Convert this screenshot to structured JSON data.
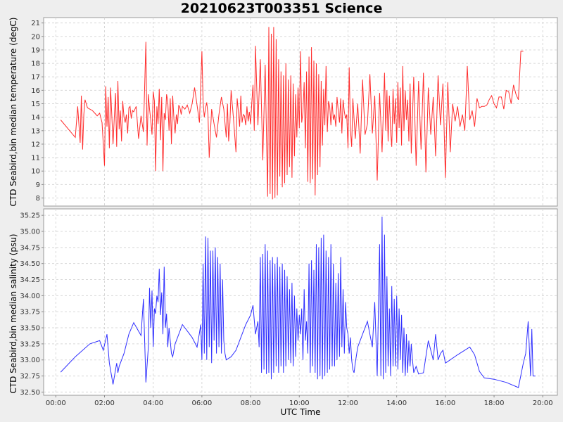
{
  "title": "20210623T003351 Science",
  "colors": {
    "temperature": "#ff2d2d",
    "salinity": "#2f2fff",
    "plot_bg": "#ffffff",
    "page_bg": "#eeeeee"
  },
  "chart_data": [
    {
      "type": "line",
      "name": "temperature",
      "ylabel": "CTD Seabird,bin median temperature (degC)",
      "xlabel": "",
      "xlim": [
        -0.5,
        20.6
      ],
      "ylim": [
        7.4,
        21.4
      ],
      "yticks": [
        8,
        9,
        10,
        11,
        12,
        13,
        14,
        15,
        16,
        17,
        18,
        19,
        20,
        21
      ],
      "ytick_labels": [
        "8",
        "9",
        "10",
        "11",
        "12",
        "13",
        "14",
        "15",
        "16",
        "17",
        "18",
        "19",
        "20",
        "21"
      ],
      "grid": true,
      "x": [
        0.2,
        0.8,
        0.9,
        1.0,
        1.05,
        1.1,
        1.15,
        1.2,
        1.3,
        1.4,
        1.5,
        1.6,
        1.7,
        1.8,
        1.9,
        2.0,
        2.05,
        2.1,
        2.15,
        2.2,
        2.25,
        2.3,
        2.35,
        2.45,
        2.5,
        2.55,
        2.6,
        2.65,
        2.7,
        2.75,
        2.8,
        2.85,
        2.9,
        2.95,
        3.0,
        3.05,
        3.1,
        3.15,
        3.2,
        3.3,
        3.4,
        3.5,
        3.6,
        3.7,
        3.75,
        3.8,
        3.85,
        3.9,
        3.95,
        4.0,
        4.05,
        4.1,
        4.15,
        4.2,
        4.25,
        4.3,
        4.35,
        4.4,
        4.45,
        4.5,
        4.55,
        4.6,
        4.65,
        4.7,
        4.75,
        4.8,
        4.85,
        4.9,
        4.95,
        5.0,
        5.05,
        5.1,
        5.15,
        5.2,
        5.3,
        5.4,
        5.5,
        5.6,
        5.7,
        5.8,
        5.9,
        6.0,
        6.05,
        6.1,
        6.15,
        6.2,
        6.25,
        6.3,
        6.4,
        6.5,
        6.6,
        6.7,
        6.8,
        6.9,
        7.0,
        7.05,
        7.1,
        7.15,
        7.2,
        7.3,
        7.4,
        7.45,
        7.5,
        7.55,
        7.6,
        7.65,
        7.7,
        7.75,
        7.8,
        7.85,
        7.9,
        7.95,
        8.0,
        8.05,
        8.1,
        8.15,
        8.2,
        8.3,
        8.4,
        8.5,
        8.6,
        8.7,
        8.75,
        8.8,
        8.85,
        8.9,
        8.95,
        9.0,
        9.05,
        9.1,
        9.15,
        9.2,
        9.25,
        9.3,
        9.35,
        9.4,
        9.45,
        9.5,
        9.55,
        9.6,
        9.65,
        9.7,
        9.75,
        9.8,
        9.85,
        9.9,
        9.95,
        10.0,
        10.05,
        10.1,
        10.15,
        10.2,
        10.25,
        10.3,
        10.35,
        10.4,
        10.45,
        10.5,
        10.55,
        10.6,
        10.65,
        10.7,
        10.75,
        10.8,
        10.85,
        10.9,
        10.95,
        11.0,
        11.05,
        11.1,
        11.15,
        11.2,
        11.25,
        11.3,
        11.35,
        11.4,
        11.45,
        11.5,
        11.55,
        11.6,
        11.65,
        11.7,
        11.75,
        11.8,
        11.85,
        11.9,
        11.95,
        12.0,
        12.05,
        12.1,
        12.15,
        12.2,
        12.3,
        12.4,
        12.5,
        12.6,
        12.7,
        12.8,
        12.9,
        13.0,
        13.1,
        13.2,
        13.3,
        13.4,
        13.5,
        13.55,
        13.6,
        13.65,
        13.7,
        13.75,
        13.8,
        13.85,
        13.9,
        13.95,
        14.0,
        14.05,
        14.1,
        14.15,
        14.2,
        14.25,
        14.3,
        14.35,
        14.4,
        14.45,
        14.5,
        14.55,
        14.6,
        14.7,
        14.8,
        14.9,
        15.0,
        15.1,
        15.2,
        15.3,
        15.4,
        15.5,
        15.6,
        15.7,
        15.8,
        15.9,
        16.0,
        16.1,
        16.2,
        16.3,
        16.4,
        16.5,
        16.6,
        16.7,
        16.8,
        16.9,
        17.0,
        17.1,
        17.2,
        17.3,
        17.4,
        17.5,
        17.6,
        17.7,
        17.8,
        17.9,
        18.0,
        18.1,
        18.2,
        18.3,
        18.4,
        18.5,
        18.6,
        18.7,
        18.8,
        18.9,
        19.0,
        19.1,
        19.2,
        19.3,
        19.4,
        19.5,
        19.6,
        19.7,
        19.8
      ],
      "y": [
        13.8,
        12.5,
        14.8,
        12.1,
        15.6,
        11.6,
        14.2,
        15.3,
        14.7,
        14.6,
        14.5,
        14.3,
        14.1,
        14.3,
        13.6,
        10.4,
        16.3,
        13.3,
        15.5,
        11.7,
        16.2,
        14.1,
        12.0,
        15.8,
        11.8,
        16.7,
        13.1,
        14.5,
        12.2,
        15.2,
        14.0,
        13.6,
        14.2,
        12.8,
        14.7,
        14.8,
        13.9,
        14.5,
        14.4,
        14.8,
        12.4,
        14.1,
        12.9,
        19.6,
        11.9,
        15.7,
        14.6,
        13.8,
        12.7,
        15.9,
        15.2,
        10.0,
        14.8,
        13.5,
        16.1,
        12.3,
        15.5,
        10.0,
        14.3,
        13.8,
        15.7,
        15.2,
        13.0,
        15.4,
        12.0,
        15.6,
        13.9,
        12.8,
        14.2,
        13.5,
        14.9,
        14.7,
        14.2,
        14.8,
        14.6,
        14.9,
        14.3,
        15.0,
        16.2,
        14.9,
        13.6,
        18.9,
        15.1,
        14.0,
        14.7,
        15.1,
        14.2,
        11.0,
        14.6,
        13.5,
        12.5,
        14.2,
        15.5,
        14.6,
        12.5,
        15.0,
        12.2,
        13.6,
        16.0,
        13.8,
        11.4,
        15.4,
        14.4,
        13.3,
        15.6,
        13.6,
        14.2,
        14.1,
        13.4,
        14.8,
        13.7,
        14.4,
        13.5,
        15.1,
        16.4,
        13.0,
        19.3,
        13.4,
        18.3,
        10.8,
        17.9,
        8.1,
        20.7,
        8.3,
        20.2,
        7.9,
        20.7,
        8.0,
        19.8,
        8.2,
        18.3,
        9.6,
        17.4,
        8.8,
        17.1,
        9.1,
        18.0,
        9.7,
        16.8,
        10.3,
        17.1,
        9.5,
        16.5,
        11.1,
        15.7,
        12.5,
        16.2,
        13.2,
        18.9,
        13.6,
        14.4,
        16.6,
        11.7,
        17.4,
        9.2,
        18.5,
        9.1,
        19.2,
        9.4,
        18.2,
        8.2,
        18.0,
        9.7,
        17.2,
        10.3,
        16.7,
        11.9,
        16.1,
        13.4,
        17.8,
        12.9,
        15.2,
        14.8,
        13.4,
        15.1,
        13.8,
        14.2,
        13.3,
        15.5,
        14.5,
        13.6,
        15.4,
        12.8,
        15.3,
        14.4,
        13.9,
        14.2,
        11.7,
        17.7,
        13.1,
        11.8,
        15.4,
        12.4,
        15.0,
        11.3,
        16.8,
        12.7,
        13.5,
        17.2,
        12.8,
        15.6,
        9.3,
        15.8,
        11.4,
        17.3,
        13.0,
        16.0,
        12.2,
        15.6,
        13.0,
        11.8,
        16.1,
        13.5,
        15.4,
        12.1,
        16.6,
        13.2,
        16.2,
        11.9,
        17.8,
        13.0,
        16.0,
        13.8,
        15.3,
        12.2,
        16.5,
        11.3,
        17.0,
        10.4,
        16.7,
        11.6,
        17.3,
        9.9,
        16.2,
        12.7,
        15.5,
        11.1,
        17.1,
        13.4,
        16.5,
        9.5,
        16.6,
        11.4,
        15.0,
        13.7,
        14.8,
        13.3,
        14.2,
        13.0,
        17.8,
        13.8,
        14.5,
        13.3,
        15.4,
        14.7,
        14.8,
        14.8,
        14.9,
        15.3,
        15.6,
        15.0,
        14.7,
        15.5,
        15.5,
        14.6,
        16.0,
        15.9,
        15.0,
        16.4,
        15.7,
        15.3,
        18.9,
        18.9
      ]
    },
    {
      "type": "line",
      "name": "salinity",
      "ylabel": "CTD Seabird,bin median salinity (psu)",
      "xlabel": "UTC Time",
      "xlim": [
        -0.5,
        20.6
      ],
      "ylim": [
        32.45,
        35.35
      ],
      "yticks": [
        32.5,
        32.75,
        33.0,
        33.25,
        33.5,
        33.75,
        34.0,
        34.25,
        34.5,
        34.75,
        35.0,
        35.25
      ],
      "ytick_labels": [
        "32.50",
        "32.75",
        "33.00",
        "33.25",
        "33.50",
        "33.75",
        "34.00",
        "34.25",
        "34.50",
        "34.75",
        "35.00",
        "35.25"
      ],
      "xticks": [
        0,
        2,
        4,
        6,
        8,
        10,
        12,
        14,
        16,
        18,
        20
      ],
      "xtick_labels": [
        "00:00",
        "02:00",
        "04:00",
        "06:00",
        "08:00",
        "10:00",
        "12:00",
        "14:00",
        "16:00",
        "18:00",
        "20:00"
      ],
      "grid": true,
      "x": [
        0.2,
        0.8,
        1.4,
        1.8,
        1.95,
        2.1,
        2.2,
        2.35,
        2.5,
        2.55,
        2.6,
        2.8,
        3.0,
        3.2,
        3.5,
        3.6,
        3.7,
        3.8,
        3.85,
        3.9,
        3.95,
        4.0,
        4.05,
        4.1,
        4.15,
        4.2,
        4.25,
        4.3,
        4.35,
        4.4,
        4.45,
        4.5,
        4.55,
        4.6,
        4.65,
        4.7,
        4.75,
        4.8,
        4.85,
        4.9,
        4.95,
        5.0,
        5.2,
        5.4,
        5.6,
        5.8,
        5.9,
        5.95,
        6.0,
        6.05,
        6.1,
        6.15,
        6.2,
        6.25,
        6.3,
        6.35,
        6.4,
        6.45,
        6.5,
        6.55,
        6.6,
        6.65,
        6.7,
        6.75,
        6.8,
        6.85,
        6.9,
        6.95,
        7.0,
        7.2,
        7.4,
        7.6,
        7.8,
        8.0,
        8.1,
        8.2,
        8.3,
        8.35,
        8.4,
        8.45,
        8.5,
        8.55,
        8.6,
        8.65,
        8.7,
        8.75,
        8.8,
        8.85,
        8.9,
        8.95,
        9.0,
        9.05,
        9.1,
        9.15,
        9.2,
        9.25,
        9.3,
        9.35,
        9.4,
        9.45,
        9.5,
        9.55,
        9.6,
        9.65,
        9.7,
        9.75,
        9.8,
        9.85,
        9.9,
        9.95,
        10.0,
        10.05,
        10.1,
        10.15,
        10.2,
        10.25,
        10.3,
        10.35,
        10.4,
        10.45,
        10.5,
        10.55,
        10.6,
        10.65,
        10.7,
        10.75,
        10.8,
        10.85,
        10.9,
        10.95,
        11.0,
        11.05,
        11.1,
        11.15,
        11.2,
        11.25,
        11.3,
        11.35,
        11.4,
        11.45,
        11.5,
        11.55,
        11.6,
        11.65,
        11.7,
        11.75,
        11.8,
        11.85,
        11.9,
        11.95,
        12.0,
        12.05,
        12.1,
        12.15,
        12.2,
        12.25,
        12.3,
        12.4,
        12.6,
        12.8,
        13.0,
        13.1,
        13.2,
        13.3,
        13.35,
        13.4,
        13.45,
        13.5,
        13.55,
        13.6,
        13.65,
        13.7,
        13.75,
        13.8,
        13.85,
        13.9,
        13.95,
        14.0,
        14.05,
        14.1,
        14.15,
        14.2,
        14.25,
        14.3,
        14.35,
        14.4,
        14.45,
        14.5,
        14.55,
        14.6,
        14.65,
        14.7,
        14.8,
        14.9,
        15.1,
        15.3,
        15.5,
        15.6,
        15.7,
        15.8,
        15.9,
        16.0,
        16.5,
        17.0,
        17.2,
        17.4,
        17.6,
        18.0,
        18.5,
        19.0,
        19.2,
        19.3,
        19.4,
        19.5,
        19.55,
        19.6,
        19.7,
        19.8
      ],
      "y": [
        32.81,
        33.05,
        33.25,
        33.3,
        33.15,
        33.4,
        32.95,
        32.62,
        32.95,
        32.8,
        32.9,
        33.1,
        33.4,
        33.58,
        33.38,
        33.95,
        32.65,
        33.2,
        34.12,
        33.5,
        34.08,
        33.2,
        33.8,
        33.72,
        34.0,
        33.9,
        34.42,
        33.7,
        34.05,
        33.4,
        34.45,
        33.5,
        33.72,
        33.2,
        33.5,
        33.3,
        33.1,
        33.05,
        33.15,
        33.25,
        33.3,
        33.35,
        33.55,
        33.45,
        33.35,
        33.2,
        33.42,
        33.55,
        33.0,
        34.5,
        33.1,
        34.92,
        33.0,
        34.9,
        33.2,
        34.7,
        32.95,
        34.7,
        33.3,
        34.75,
        33.1,
        34.6,
        33.2,
        34.5,
        33.1,
        34.25,
        33.3,
        33.1,
        33.0,
        33.05,
        33.15,
        33.35,
        33.55,
        33.7,
        33.85,
        33.4,
        33.6,
        33.2,
        34.6,
        32.8,
        34.65,
        32.85,
        34.8,
        32.78,
        34.7,
        32.8,
        34.55,
        32.7,
        34.6,
        32.8,
        34.5,
        32.9,
        34.6,
        32.8,
        34.45,
        32.9,
        34.5,
        32.8,
        34.4,
        32.9,
        34.3,
        33.0,
        34.1,
        32.95,
        34.2,
        32.9,
        34.0,
        33.05,
        33.8,
        33.3,
        33.7,
        33.4,
        33.8,
        33.0,
        34.1,
        33.3,
        33.6,
        33.1,
        34.5,
        32.8,
        34.55,
        32.9,
        34.4,
        32.8,
        34.8,
        32.7,
        34.75,
        32.75,
        34.9,
        32.7,
        34.95,
        32.75,
        34.7,
        32.8,
        34.6,
        32.85,
        34.8,
        32.9,
        34.5,
        32.9,
        34.2,
        33.0,
        34.35,
        33.05,
        34.6,
        33.2,
        34.1,
        33.1,
        33.9,
        33.5,
        33.4,
        33.1,
        33.35,
        33.0,
        32.85,
        32.8,
        32.95,
        33.2,
        33.4,
        33.6,
        33.2,
        33.9,
        32.75,
        34.8,
        32.75,
        35.23,
        32.7,
        34.95,
        32.8,
        34.3,
        32.9,
        33.8,
        32.75,
        34.15,
        32.9,
        33.95,
        32.9,
        34.0,
        32.85,
        33.8,
        33.0,
        33.7,
        32.8,
        33.5,
        32.75,
        33.4,
        32.8,
        33.3,
        32.9,
        33.25,
        33.0,
        32.8,
        32.9,
        32.78,
        32.8,
        33.3,
        33.0,
        33.4,
        33.0,
        33.1,
        33.15,
        32.95,
        33.08,
        33.2,
        33.08,
        32.82,
        32.72,
        32.7,
        32.65,
        32.57,
        32.95,
        33.1,
        33.6,
        32.75,
        33.48,
        32.75,
        32.75
      ]
    }
  ]
}
